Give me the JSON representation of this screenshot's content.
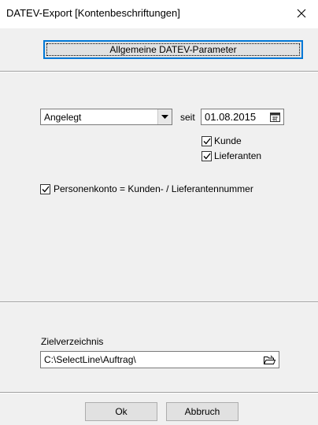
{
  "window": {
    "title": "DATEV-Export [Kontenbeschriftungen]"
  },
  "header": {
    "params_button_label": "Allgemeine DATEV-Parameter"
  },
  "filter": {
    "status_value": "Angelegt",
    "since_label": "seit",
    "date_value": "01.08.2015",
    "kunde_label": "Kunde",
    "kunde_checked": true,
    "lieferanten_label": "Lieferanten",
    "lieferanten_checked": true,
    "personenkonto_label": "Personenkonto = Kunden- / Lieferantennummer",
    "personenkonto_checked": true
  },
  "target": {
    "label": "Zielverzeichnis",
    "path_value": "C:\\SelectLine\\Auftrag\\"
  },
  "footer": {
    "ok_label": "Ok",
    "cancel_label": "Abbruch"
  }
}
